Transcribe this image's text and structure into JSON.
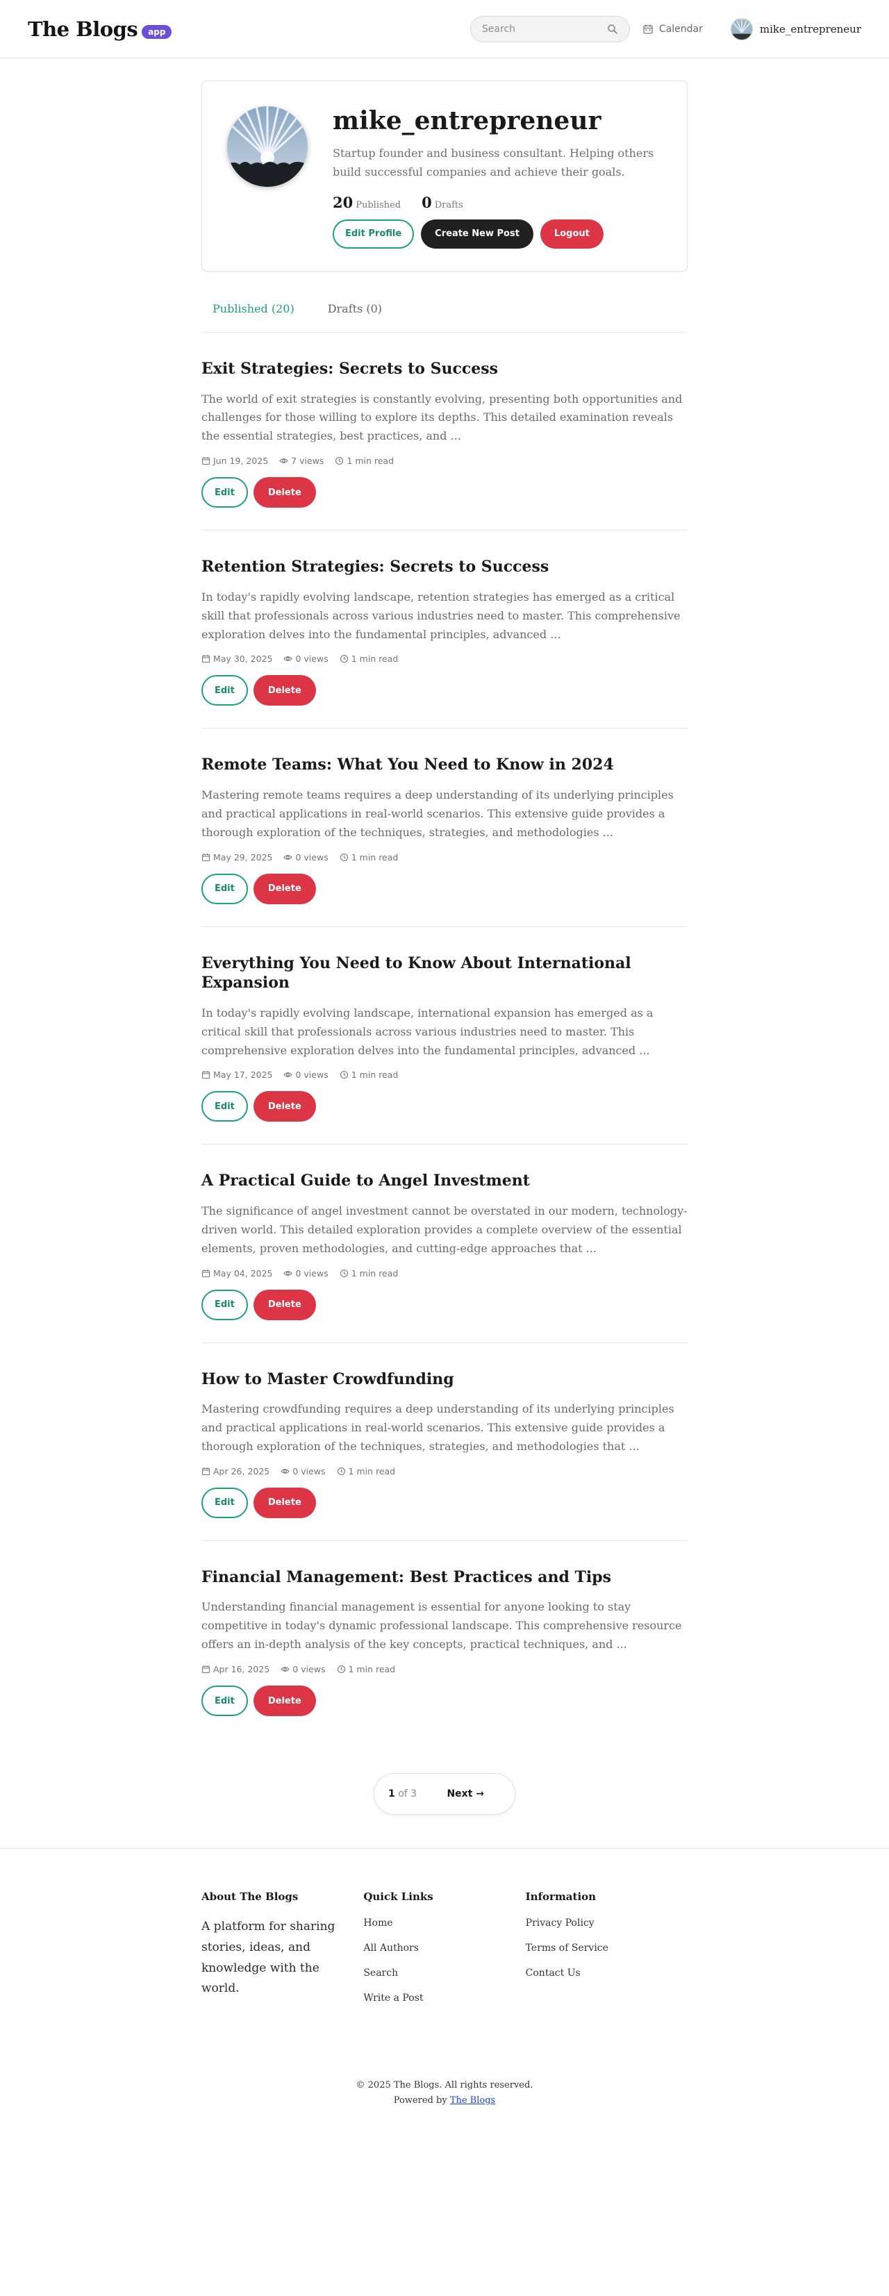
{
  "header": {
    "brand": "The Blogs",
    "badge": "app",
    "search_placeholder": "Search",
    "calendar_label": "Calendar",
    "username": "mike_entrepreneur"
  },
  "profile": {
    "name": "mike_entrepreneur",
    "bio": "Startup founder and business consultant. Helping others build successful companies and achieve their goals.",
    "published_count": "20",
    "published_label": "Published",
    "drafts_count": "0",
    "drafts_label": "Drafts",
    "edit_profile_label": "Edit Profile",
    "create_post_label": "Create New Post",
    "logout_label": "Logout"
  },
  "tabs": {
    "published": "Published (20)",
    "drafts": "Drafts (0)"
  },
  "post_actions": {
    "edit": "Edit",
    "delete": "Delete"
  },
  "posts": [
    {
      "title": "Exit Strategies: Secrets to Success",
      "excerpt": "The world of exit strategies is constantly evolving, presenting both opportunities and challenges for those willing to explore its depths. This detailed examination reveals the essential strategies, best practices, and ...",
      "date": "Jun 19, 2025",
      "views": "7 views",
      "read_time": "1 min read"
    },
    {
      "title": "Retention Strategies: Secrets to Success",
      "excerpt": "In today's rapidly evolving landscape, retention strategies has emerged as a critical skill that professionals across various industries need to master. This comprehensive exploration delves into the fundamental principles, advanced ...",
      "date": "May 30, 2025",
      "views": "0 views",
      "read_time": "1 min read"
    },
    {
      "title": "Remote Teams: What You Need to Know in 2024",
      "excerpt": "Mastering remote teams requires a deep understanding of its underlying principles and practical applications in real-world scenarios. This extensive guide provides a thorough exploration of the techniques, strategies, and methodologies ...",
      "date": "May 29, 2025",
      "views": "0 views",
      "read_time": "1 min read"
    },
    {
      "title": "Everything You Need to Know About International Expansion",
      "excerpt": "In today's rapidly evolving landscape, international expansion has emerged as a critical skill that professionals across various industries need to master. This comprehensive exploration delves into the fundamental principles, advanced ...",
      "date": "May 17, 2025",
      "views": "0 views",
      "read_time": "1 min read"
    },
    {
      "title": "A Practical Guide to Angel Investment",
      "excerpt": "The significance of angel investment cannot be overstated in our modern, technology-driven world. This detailed exploration provides a complete overview of the essential elements, proven methodologies, and cutting-edge approaches that ...",
      "date": "May 04, 2025",
      "views": "0 views",
      "read_time": "1 min read"
    },
    {
      "title": "How to Master Crowdfunding",
      "excerpt": "Mastering crowdfunding requires a deep understanding of its underlying principles and practical applications in real-world scenarios. This extensive guide provides a thorough exploration of the techniques, strategies, and methodologies that ...",
      "date": "Apr 26, 2025",
      "views": "0 views",
      "read_time": "1 min read"
    },
    {
      "title": "Financial Management: Best Practices and Tips",
      "excerpt": "Understanding financial management is essential for anyone looking to stay competitive in today's dynamic professional landscape. This comprehensive resource offers an in-depth analysis of the key concepts, practical techniques, and ...",
      "date": "Apr 16, 2025",
      "views": "0 views",
      "read_time": "1 min read"
    }
  ],
  "pagination": {
    "current": "1",
    "of_total": "of 3",
    "next": "Next →"
  },
  "footer": {
    "about_heading": "About The Blogs",
    "about_text": "A platform for sharing stories, ideas, and knowledge with the world.",
    "quick_links_heading": "Quick Links",
    "quick_links": [
      "Home",
      "All Authors",
      "Search",
      "Write a Post"
    ],
    "info_heading": "Information",
    "info_links": [
      "Privacy Policy",
      "Terms of Service",
      "Contact Us"
    ],
    "copyright": "© 2025 The Blogs. All rights reserved.",
    "powered_by": "Powered by",
    "powered_link": "The Blogs"
  },
  "colors": {
    "accent": "#1fa07c",
    "danger": "#dc3545",
    "dark": "#202020",
    "badge": "#6c4fd6"
  }
}
